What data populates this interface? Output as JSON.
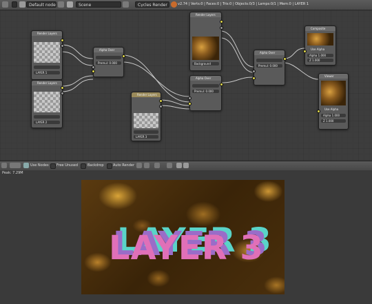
{
  "header": {
    "screen_layout": "Default nodes",
    "scene": "Scene",
    "engine": "Cycles Render",
    "stats": "v2.74 | Verts:0 | Faces:0 | Tris:0 | Objects:0/3 | Lamps:0/1 | Mem:0 | LAYER 1"
  },
  "nodes": {
    "node_a_title": "Render Layers",
    "node_a_field": "LAYER 1",
    "node_b_title": "Render Layers",
    "node_b_field": "LAYER 2",
    "mix1_title": "Alpha Over",
    "mix1_field": "Premul: 0.000",
    "img_title": "Render Layers",
    "img_field": "Background",
    "mix2_title": "Alpha Over",
    "mix2_field": "Premul: 0.000",
    "layer_title": "Render Layers",
    "layer_field": "LAYER 3",
    "mix3_title": "Alpha Over",
    "mix3_field": "Premul: 0.000",
    "comp_title": "Composite",
    "comp_alpha": "Use Alpha",
    "comp_field1": "Alpha 1.000",
    "comp_field2": "Z 1.000",
    "viewer_title": "Viewer",
    "viewer_alpha": "Use Alpha",
    "viewer_field1": "Alpha 1.000",
    "viewer_field2": "Z 1.000"
  },
  "toolbar": {
    "use_nodes": "Use Nodes",
    "free_unused": "Free Unused",
    "backdrop": "Backdrop",
    "auto_render": "Auto Render"
  },
  "viewer": {
    "peak": "Peak: 7.29M",
    "render_text": "LAYER 3"
  }
}
